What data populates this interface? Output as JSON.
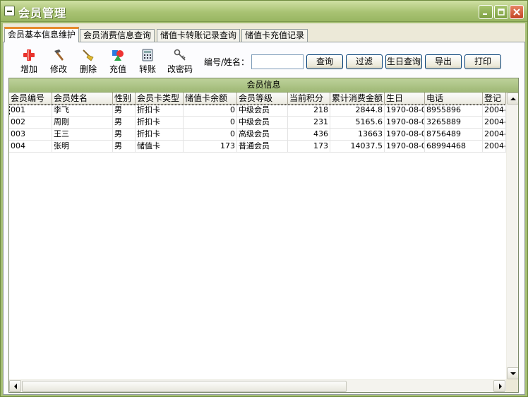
{
  "window": {
    "title": "会员管理"
  },
  "tabs": [
    {
      "label": "会员基本信息维护"
    },
    {
      "label": "会员消费信息查询"
    },
    {
      "label": "储值卡转账记录查询"
    },
    {
      "label": "储值卡充值记录"
    }
  ],
  "toolbar": {
    "add": "增加",
    "edit": "修改",
    "delete": "删除",
    "recharge": "充值",
    "transfer": "转账",
    "change_password": "改密码",
    "search_label": "编号/姓名：",
    "search_value": "",
    "query_button": "查询",
    "filter_button": "过滤",
    "birthday_button": "生日查询",
    "export_button": "导出",
    "print_button": "打印"
  },
  "grid": {
    "caption": "会员信息",
    "columns": [
      "会员编号",
      "会员姓名",
      "性别",
      "会员卡类型",
      "储值卡余额",
      "会员等级",
      "当前积分",
      "累计消费金额",
      "生日",
      "电话",
      "登记"
    ],
    "rows": [
      [
        "001",
        "李飞",
        "男",
        "折扣卡",
        "0",
        "中级会员",
        "218",
        "2844.8",
        "1970-08-0",
        "8955896",
        "2004-"
      ],
      [
        "002",
        "周刚",
        "男",
        "折扣卡",
        "0",
        "中级会员",
        "231",
        "5165.6",
        "1970-08-0",
        "3265889",
        "2004-"
      ],
      [
        "003",
        "王三",
        "男",
        "折扣卡",
        "0",
        "高级会员",
        "436",
        "13663",
        "1970-08-0",
        "8756489",
        "2004-"
      ],
      [
        "004",
        "张明",
        "男",
        "储值卡",
        "173",
        "普通会员",
        "173",
        "14037.5",
        "1970-08-0",
        "68994468",
        "2004-"
      ]
    ]
  },
  "colors": {
    "titlebar": "#a9c373",
    "caption": "#a6bf76",
    "active_tab_accent": "#e68b2c",
    "close_button": "#c34424"
  },
  "icons": {
    "add": "plus-icon",
    "edit": "hammer-icon",
    "delete": "broom-icon",
    "recharge": "shapes-icon",
    "transfer": "calculator-icon",
    "change_password": "key-icon"
  }
}
